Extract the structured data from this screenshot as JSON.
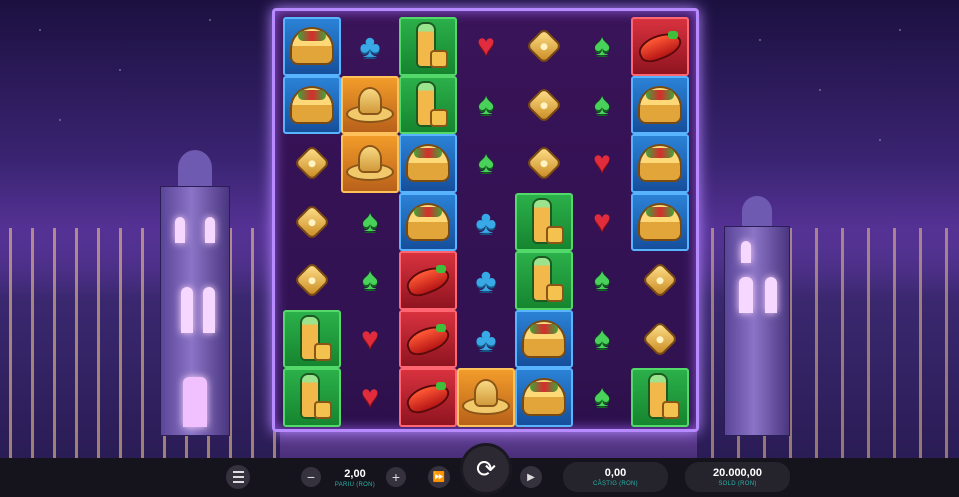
{
  "game": {
    "grid": [
      [
        "taco",
        "club",
        "tequila",
        "heart",
        "diamond",
        "spade",
        "pepper"
      ],
      [
        "taco",
        "sombrero",
        "tequila",
        "spade",
        "diamond",
        "spade",
        "taco"
      ],
      [
        "diamond",
        "sombrero",
        "taco",
        "spade",
        "diamond",
        "heart",
        "taco"
      ],
      [
        "diamond",
        "spade",
        "taco",
        "club",
        "tequila",
        "heart",
        "taco"
      ],
      [
        "diamond",
        "spade",
        "pepper",
        "club",
        "tequila",
        "spade",
        "diamond"
      ],
      [
        "tequila",
        "heart",
        "pepper",
        "club",
        "taco",
        "spade",
        "diamond"
      ],
      [
        "tequila",
        "heart",
        "pepper",
        "sombrero",
        "taco",
        "spade",
        "tequila"
      ]
    ],
    "highlight": [
      [
        "blue",
        "",
        "green",
        "",
        "",
        "",
        "red"
      ],
      [
        "blue",
        "orange",
        "green",
        "",
        "",
        "",
        "blue"
      ],
      [
        "",
        "orange",
        "blue",
        "",
        "",
        "",
        "blue"
      ],
      [
        "",
        "",
        "blue",
        "",
        "green",
        "",
        "blue"
      ],
      [
        "",
        "",
        "red",
        "",
        "green",
        "",
        ""
      ],
      [
        "green",
        "",
        "red",
        "",
        "blue",
        "",
        ""
      ],
      [
        "green",
        "",
        "red",
        "orange",
        "blue",
        "",
        "green"
      ]
    ]
  },
  "controls": {
    "bet_value": "2,00",
    "bet_label": "PARIU (RON)",
    "win_value": "0,00",
    "win_label": "CÂȘTIG (RON)",
    "balance_value": "20.000,00",
    "balance_label": "SOLD (RON)",
    "minus": "−",
    "plus": "+"
  },
  "colors": {
    "accent_teal": "#29b3a8",
    "frame_glow": "#b78bff"
  }
}
